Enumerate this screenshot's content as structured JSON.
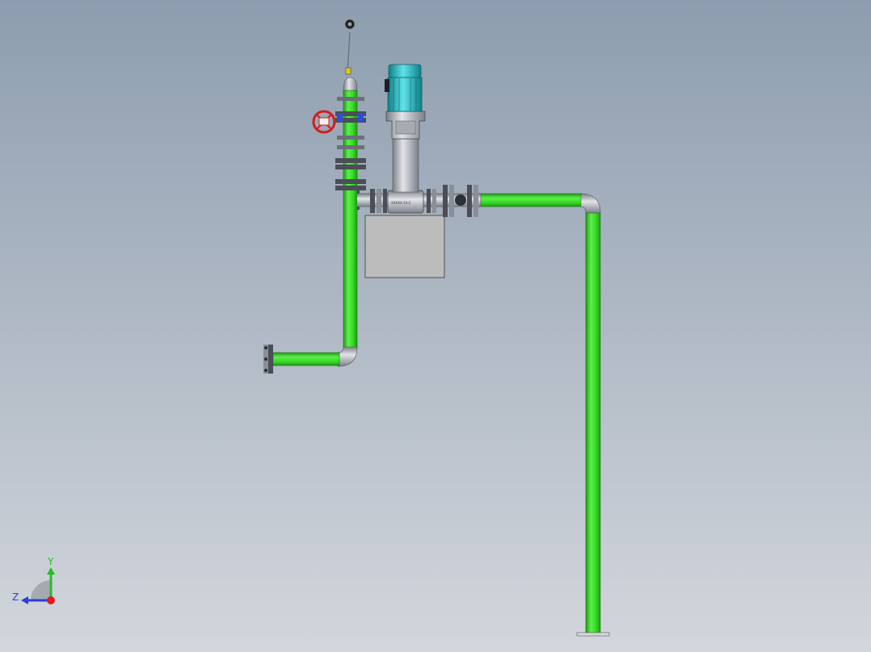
{
  "viewport": {
    "background_top": "#8d9daf",
    "background_bottom": "#d3d6dc"
  },
  "colors": {
    "pipe_green": "#3be02a",
    "pipe_green_dark": "#1f9a14",
    "pipe_gray": "#b9bdc4",
    "flange_dark": "#4a4e56",
    "motor_teal": "#25b9c2",
    "valve_red": "#d61c1c",
    "valve_blue": "#2a4fd6",
    "base_gray": "#bcbcbc"
  },
  "pump": {
    "nameplate": "XXXXX-1X-2"
  },
  "triad": {
    "y_label": "Y",
    "z_label": "Z",
    "y_color": "#22c022",
    "z_color": "#2a3fd8",
    "x_color": "#e11b1b"
  }
}
